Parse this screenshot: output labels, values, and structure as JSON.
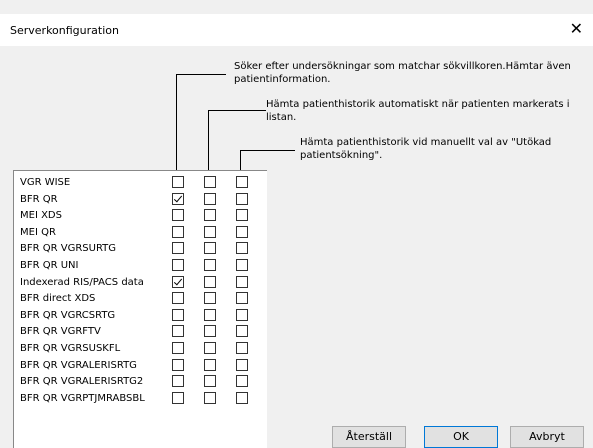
{
  "dialog": {
    "title": "Serverkonfiguration",
    "close_glyph": "✕"
  },
  "descriptions": {
    "col1": "Söker efter undersökningar som matchar sökvillkoren.Hämtar även patientinformation.",
    "col2": "Hämta patienthistorik automatiskt när patienten markerats i listan.",
    "col3": "Hämta patienthistorik vid manuellt val av \"Utökad patientsökning\"."
  },
  "servers": [
    {
      "name": "VGR WISE",
      "c1": false,
      "c2": false,
      "c3": false
    },
    {
      "name": "BFR QR",
      "c1": true,
      "c2": false,
      "c3": false
    },
    {
      "name": "MEI XDS",
      "c1": false,
      "c2": false,
      "c3": false
    },
    {
      "name": "MEI QR",
      "c1": false,
      "c2": false,
      "c3": false
    },
    {
      "name": "BFR QR VGRSURTG",
      "c1": false,
      "c2": false,
      "c3": false
    },
    {
      "name": "BFR QR UNI",
      "c1": false,
      "c2": false,
      "c3": false
    },
    {
      "name": "Indexerad RIS/PACS data",
      "c1": true,
      "c2": false,
      "c3": false
    },
    {
      "name": "BFR direct XDS",
      "c1": false,
      "c2": false,
      "c3": false
    },
    {
      "name": "BFR QR VGRCSRTG",
      "c1": false,
      "c2": false,
      "c3": false
    },
    {
      "name": "BFR QR VGRFTV",
      "c1": false,
      "c2": false,
      "c3": false
    },
    {
      "name": "BFR QR VGRSUSKFL",
      "c1": false,
      "c2": false,
      "c3": false
    },
    {
      "name": "BFR QR VGRALERISRTG",
      "c1": false,
      "c2": false,
      "c3": false
    },
    {
      "name": "BFR QR VGRALERISRTG2",
      "c1": false,
      "c2": false,
      "c3": false
    },
    {
      "name": "BFR QR VGRPTJMRABSBL",
      "c1": false,
      "c2": false,
      "c3": false
    }
  ],
  "buttons": {
    "reset": "Återställ",
    "ok": "OK",
    "cancel": "Avbryt"
  }
}
